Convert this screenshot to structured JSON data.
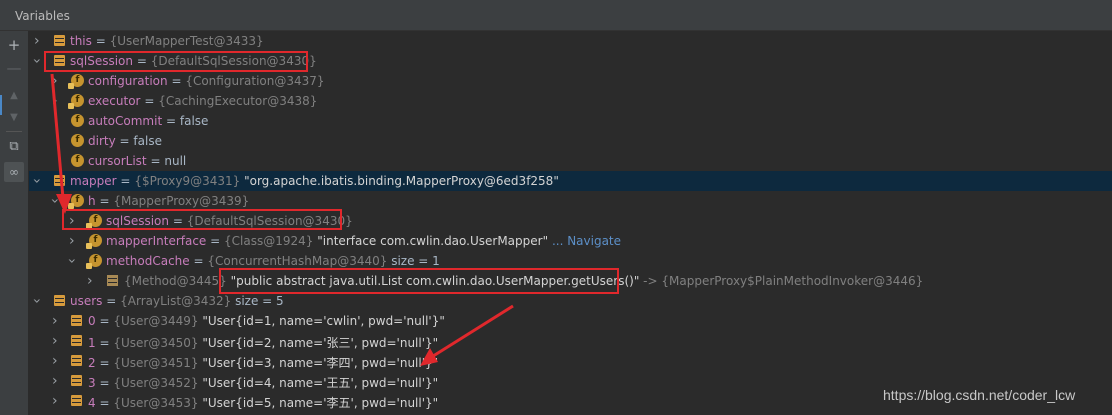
{
  "panel_title": "Variables",
  "sidebar_icons": [
    "plus-icon",
    "minus-icon",
    "arrow-up-icon",
    "arrow-down-icon",
    "copy-icon",
    "glasses-icon"
  ],
  "rows": [
    {
      "name": "this",
      "ref": "{UserMapperTest@3433}"
    },
    {
      "name": "sqlSession",
      "ref": "{DefaultSqlSession@3430}"
    },
    {
      "name": "configuration",
      "ref": "{Configuration@3437}"
    },
    {
      "name": "executor",
      "ref": "{CachingExecutor@3438}"
    },
    {
      "name": "autoCommit",
      "value": "false"
    },
    {
      "name": "dirty",
      "value": "false"
    },
    {
      "name": "cursorList",
      "value": "null"
    },
    {
      "name": "mapper",
      "ref": "{$Proxy9@3431}",
      "str": "\"org.apache.ibatis.binding.MapperProxy@6ed3f258\""
    },
    {
      "name": "h",
      "ref": "{MapperProxy@3439}"
    },
    {
      "name": "sqlSession",
      "ref": "{DefaultSqlSession@3430}"
    },
    {
      "name": "mapperInterface",
      "ref": "{Class@1924}",
      "str": "\"interface com.cwlin.dao.UserMapper\"",
      "link": "... Navigate"
    },
    {
      "name": "methodCache",
      "ref": "{ConcurrentHashMap@3440}",
      "extra": "size = 1"
    },
    {
      "key_ref": "{Method@3445}",
      "str": "\"public abstract java.util.List com.cwlin.dao.UserMapper.getUsers()\"",
      "arrow": "->",
      "ref2": "{MapperProxy$PlainMethodInvoker@3446}"
    },
    {
      "name": "users",
      "ref": "{ArrayList@3432}",
      "extra": "size = 5"
    },
    {
      "name": "0",
      "ref": "{User@3449}",
      "str": "\"User{id=1, name='cwlin', pwd='null'}\""
    },
    {
      "name": "1",
      "ref": "{User@3450}",
      "str": "\"User{id=2, name='张三', pwd='null'}\""
    },
    {
      "name": "2",
      "ref": "{User@3451}",
      "str": "\"User{id=3, name='李四', pwd='null'}\""
    },
    {
      "name": "3",
      "ref": "{User@3452}",
      "str": "\"User{id=4, name='王五', pwd='null'}\""
    },
    {
      "name": "4",
      "ref": "{User@3453}",
      "str": "\"User{id=5, name='李五', pwd='null'}\""
    }
  ],
  "equals": "=",
  "watermark": "https://blog.csdn.net/coder_lcw",
  "colors": {
    "highlight_box": "#e0282c",
    "selection": "#0d293e"
  }
}
